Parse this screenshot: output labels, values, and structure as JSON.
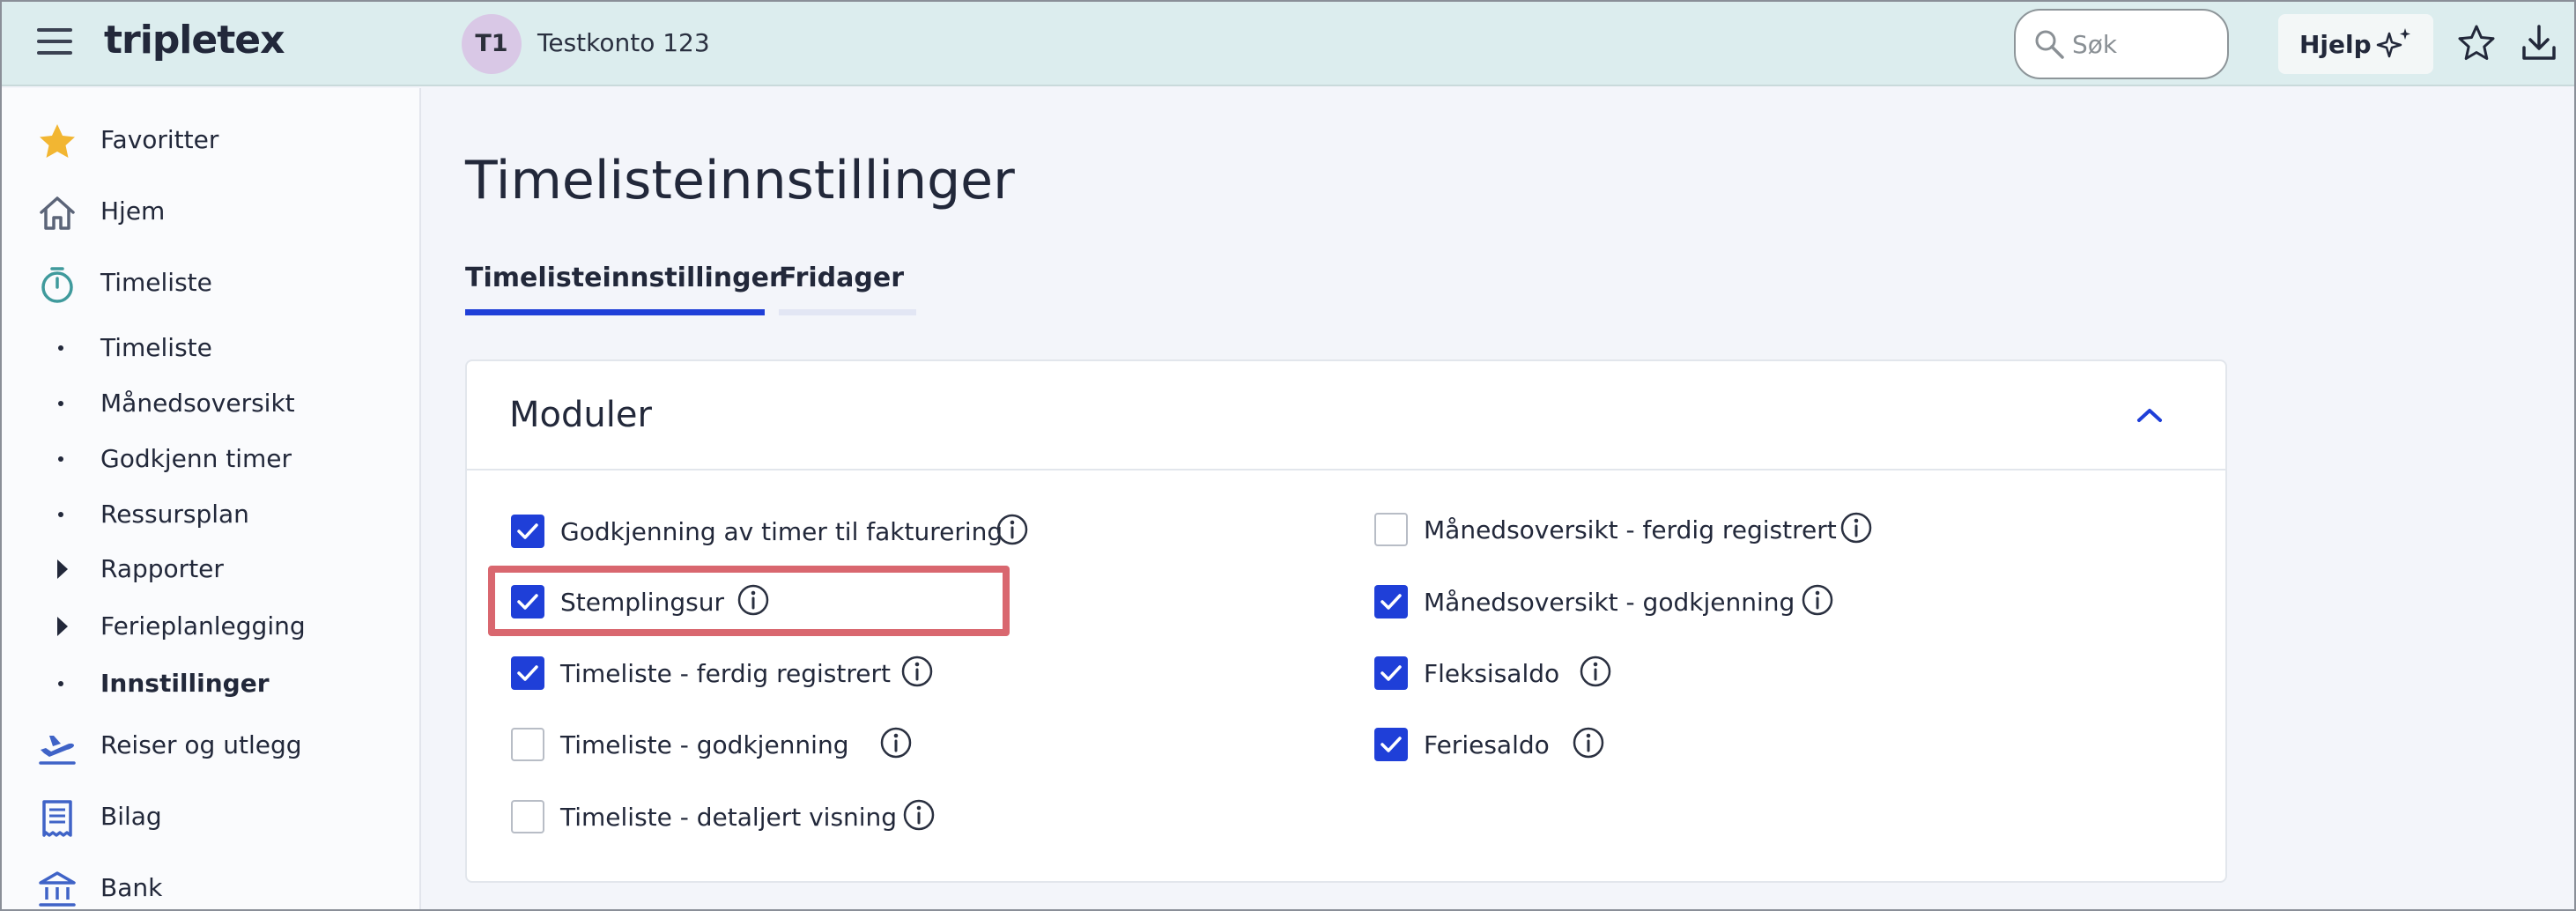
{
  "app": {
    "logo": "tripletex",
    "company": {
      "initials": "T1",
      "name": "Testkonto 123"
    },
    "search": {
      "placeholder": "Søk"
    },
    "help_label": "Hjelp"
  },
  "sidebar": {
    "items": [
      {
        "label": "Favoritter",
        "icon": "star-icon"
      },
      {
        "label": "Hjem",
        "icon": "home-icon"
      },
      {
        "label": "Timeliste",
        "icon": "stopwatch-icon"
      },
      {
        "label": "Timeliste",
        "icon": "bullet"
      },
      {
        "label": "Månedsoversikt",
        "icon": "bullet"
      },
      {
        "label": "Godkjenn timer",
        "icon": "bullet"
      },
      {
        "label": "Ressursplan",
        "icon": "bullet"
      },
      {
        "label": "Rapporter",
        "icon": "caret-right-icon"
      },
      {
        "label": "Ferieplanlegging",
        "icon": "caret-right-icon"
      },
      {
        "label": "Innstillinger",
        "icon": "bullet",
        "active": true
      },
      {
        "label": "Reiser og utlegg",
        "icon": "airplane-icon"
      },
      {
        "label": "Bilag",
        "icon": "receipt-icon"
      },
      {
        "label": "Bank",
        "icon": "bank-icon"
      }
    ]
  },
  "main": {
    "title": "Timelisteinnstillinger",
    "tabs": [
      {
        "label": "Timelisteinnstillinger",
        "active": true
      },
      {
        "label": "Fridager",
        "active": false
      }
    ],
    "card": {
      "title": "Moduler",
      "options_left": [
        {
          "label": "Godkjenning av timer til fakturering",
          "checked": true
        },
        {
          "label": "Stemplingsur",
          "checked": true,
          "highlighted": true
        },
        {
          "label": "Timeliste - ferdig registrert",
          "checked": true
        },
        {
          "label": "Timeliste - godkjenning",
          "checked": false
        },
        {
          "label": "Timeliste - detaljert visning",
          "checked": false
        }
      ],
      "options_right": [
        {
          "label": "Månedsoversikt - ferdig registrert",
          "checked": false
        },
        {
          "label": "Månedsoversikt - godkjenning",
          "checked": true
        },
        {
          "label": "Fleksisaldo",
          "checked": true
        },
        {
          "label": "Feriesaldo",
          "checked": true
        }
      ]
    }
  },
  "colors": {
    "topbar": "#dcedee",
    "accent": "#1f3fd8",
    "highlight": "#d9676f",
    "star": "#f2b632"
  }
}
